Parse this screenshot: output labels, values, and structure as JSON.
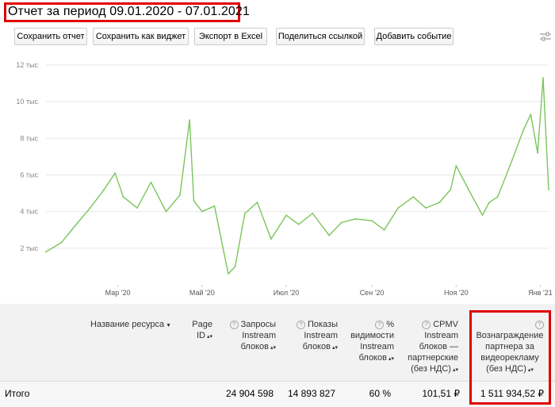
{
  "report": {
    "title": "Отчет за период 09.01.2020 - 07.01.2021"
  },
  "toolbar": {
    "save_report": "Сохранить отчет",
    "save_widget": "Сохранить как виджет",
    "export_excel": "Экспорт в Excel",
    "share_link": "Поделиться ссылкой",
    "add_event": "Добавить событие"
  },
  "chart_data": {
    "type": "line",
    "y_ticks": [
      "2 тыс",
      "4 тыс",
      "6 тыс",
      "8 тыс",
      "10 тыс",
      "12 тыс"
    ],
    "x_ticks": [
      "Мар '20",
      "Май '20",
      "Июл '20",
      "Сен '20",
      "Ноя '20",
      "Янв '21"
    ],
    "ylim": [
      0,
      12000
    ],
    "grid": true,
    "series": [
      {
        "color": "#7ac55a",
        "x": [
          "2020-01-09",
          "2020-01-20",
          "2020-02-01",
          "2020-02-10",
          "2020-02-20",
          "2020-02-28",
          "2020-03-05",
          "2020-03-15",
          "2020-03-25",
          "2020-04-05",
          "2020-04-15",
          "2020-04-22",
          "2020-04-25",
          "2020-05-01",
          "2020-05-10",
          "2020-05-20",
          "2020-05-25",
          "2020-06-01",
          "2020-06-10",
          "2020-06-20",
          "2020-07-01",
          "2020-07-10",
          "2020-07-20",
          "2020-08-01",
          "2020-08-10",
          "2020-08-20",
          "2020-09-01",
          "2020-09-10",
          "2020-09-20",
          "2020-10-01",
          "2020-10-10",
          "2020-10-20",
          "2020-10-28",
          "2020-11-01",
          "2020-11-10",
          "2020-11-20",
          "2020-11-25",
          "2020-12-01",
          "2020-12-10",
          "2020-12-20",
          "2020-12-25",
          "2020-12-30",
          "2021-01-03",
          "2021-01-07"
        ],
        "values": [
          1800,
          2300,
          3400,
          4200,
          5200,
          6100,
          4800,
          4200,
          5600,
          4000,
          4900,
          9000,
          4600,
          4000,
          4300,
          600,
          1000,
          3900,
          4500,
          2500,
          3800,
          3300,
          3900,
          2700,
          3400,
          3600,
          3500,
          3000,
          4200,
          4800,
          4200,
          4500,
          5200,
          6500,
          5200,
          3800,
          4500,
          4800,
          6500,
          8500,
          9300,
          7200,
          11300,
          5200
        ]
      }
    ]
  },
  "table": {
    "headers": {
      "resource": "Название ресурса",
      "page_id": [
        "Page",
        "ID"
      ],
      "requests": [
        "Запросы",
        "Instream",
        "блоков"
      ],
      "shows": [
        "Показы",
        "Instream",
        "блоков"
      ],
      "visibility": [
        "%",
        "видимости",
        "Instream",
        "блоков"
      ],
      "cpmv": [
        "CPMV",
        "Instream",
        "блоков —",
        "партнерские",
        "(без НДС)"
      ],
      "reward": [
        "Вознаграждение",
        "партнера за",
        "видеорекламу",
        "(без НДС)"
      ]
    },
    "totals": {
      "label": "Итого",
      "requests": "24 904 598",
      "shows": "14 893 827",
      "visibility": "60 %",
      "cpmv": "101,51 ₽",
      "reward": "1 511 934,52 ₽"
    }
  },
  "colors": {
    "highlight": "#e00000",
    "line": "#7ac55a"
  }
}
